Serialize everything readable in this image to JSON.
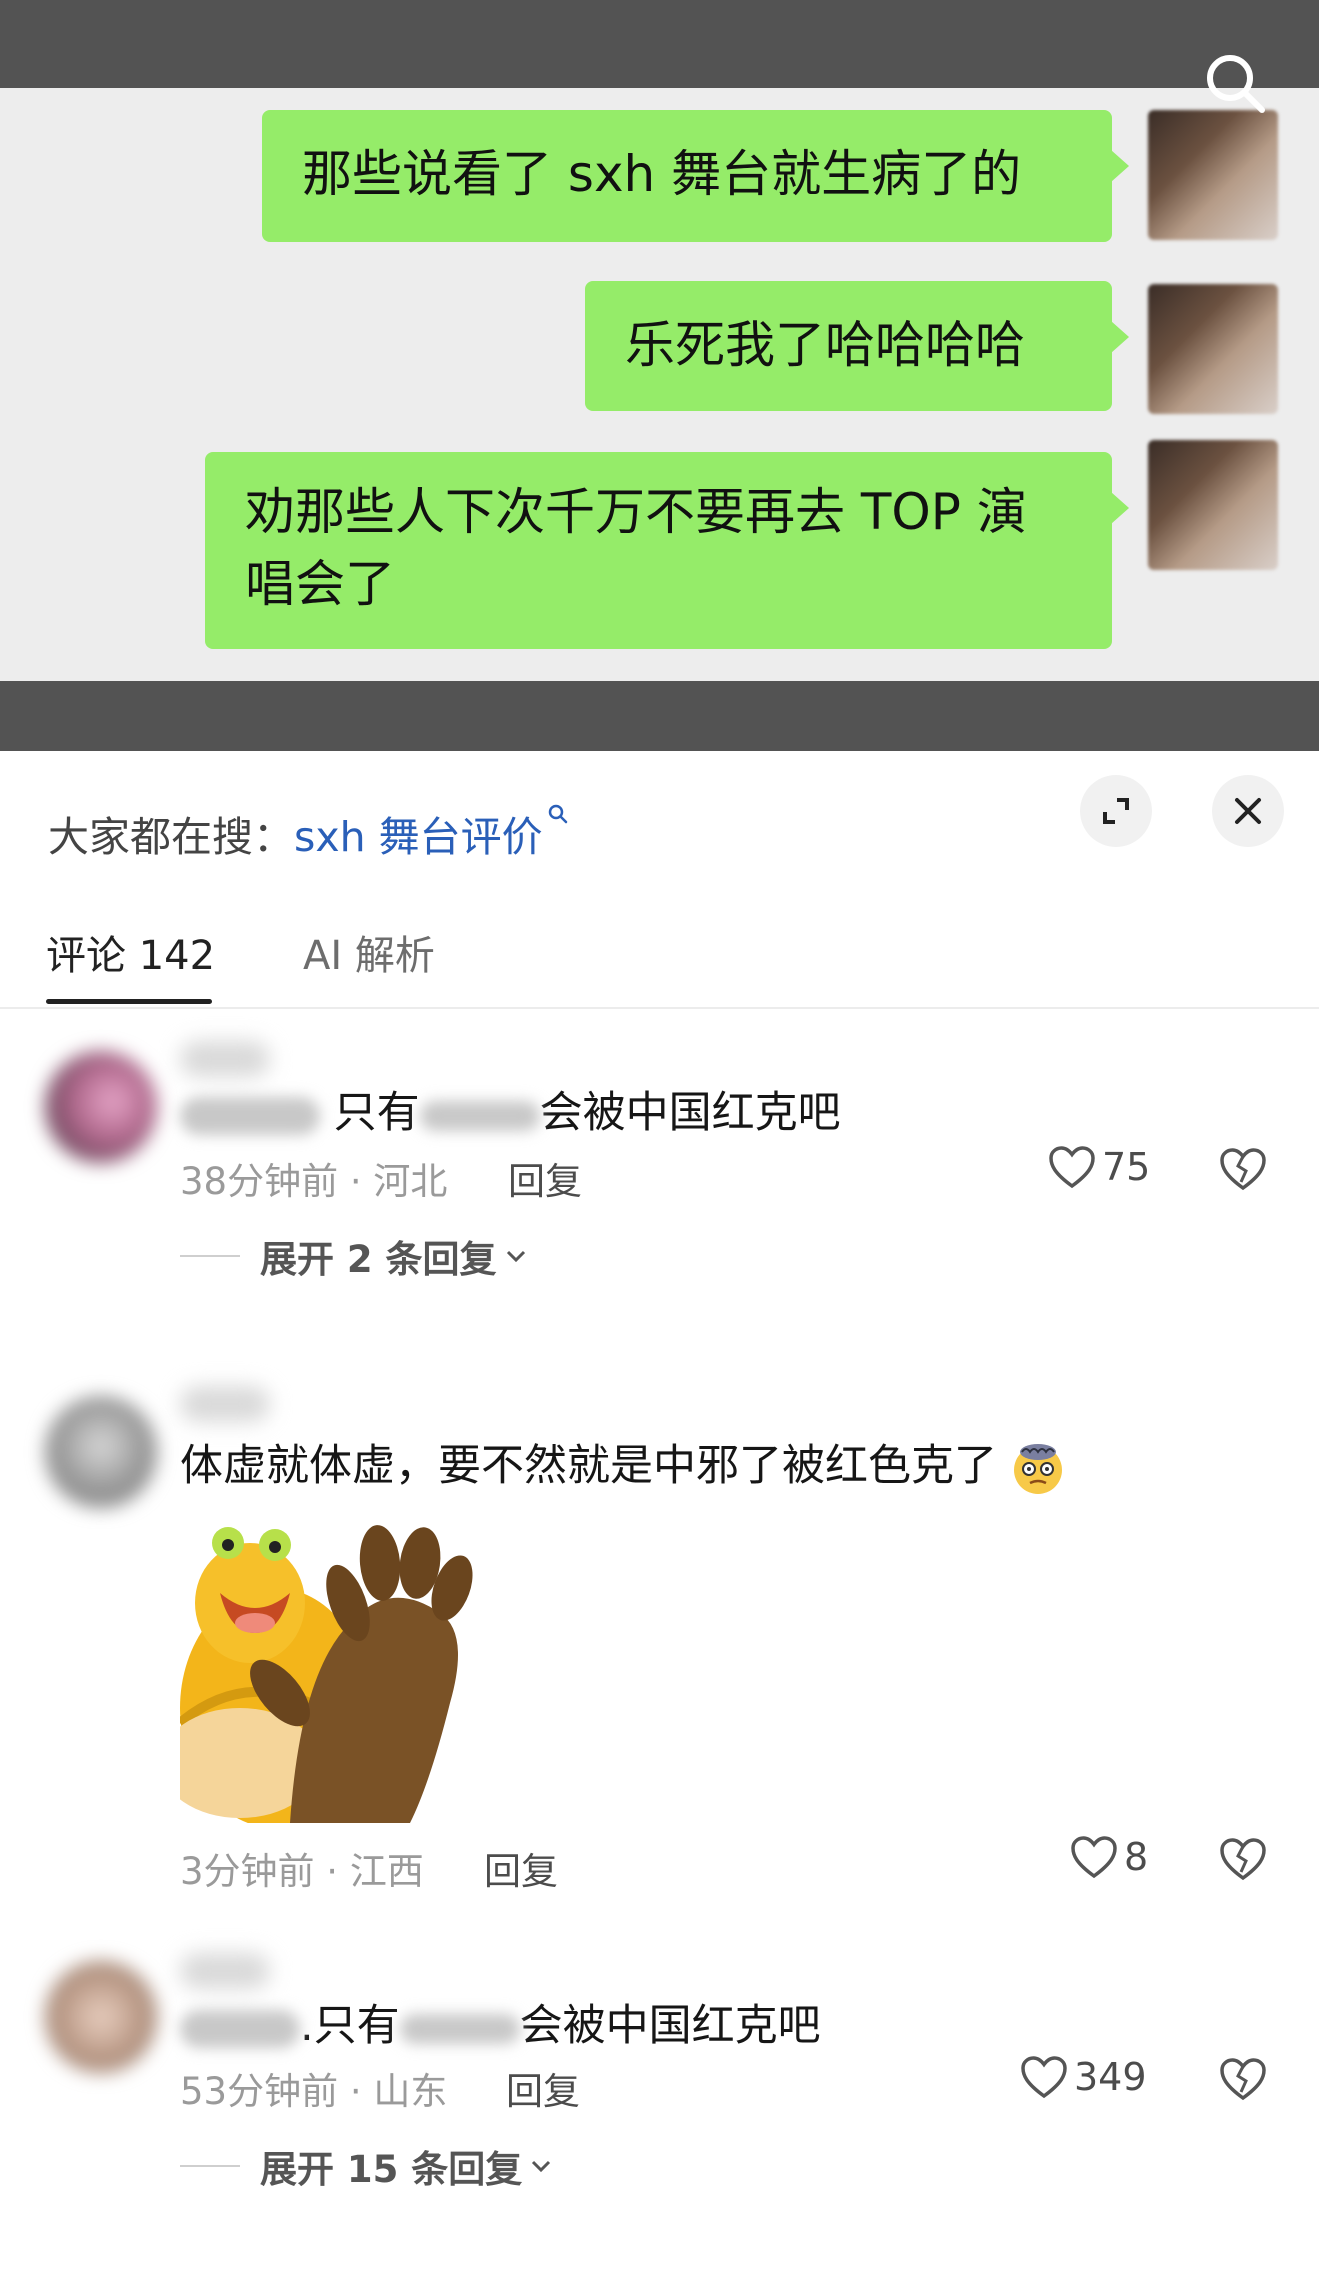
{
  "chat": {
    "messages": [
      {
        "text": "那些说看了 sxh 舞台就生病了的"
      },
      {
        "text": "乐死我了哈哈哈哈"
      },
      {
        "text": "劝那些人下次千万不要再去 TOP 演唱会了"
      }
    ],
    "bubble_color": "#95ec69"
  },
  "sheet": {
    "search_prefix": "大家都在搜：",
    "search_term": "sxh 舞台评价",
    "tabs": [
      {
        "label": "评论 142",
        "active": true
      },
      {
        "label": "AI 解析",
        "active": false
      }
    ],
    "comments": [
      {
        "text_pre": "",
        "text": "只有",
        "text_mid": "会被中国红克吧",
        "time_loc": "38分钟前 · 河北",
        "reply": "回复",
        "likes": "75",
        "expand": "展开 2 条回复"
      },
      {
        "text": "体虚就体虚，要不然就是中邪了被红色克了",
        "time_loc": "3分钟前 · 江西",
        "reply": "回复",
        "likes": "8",
        "emoji": "dizzy-face-emoji",
        "sticker": "cartoon-sticker-image"
      },
      {
        "text_pre": ".",
        "text": "只有",
        "text_mid": "会被中国红克吧",
        "time_loc": "53分钟前 · 山东",
        "reply": "回复",
        "likes": "349",
        "expand": "展开 15 条回复"
      }
    ],
    "link_color": "#2a5fb8"
  },
  "icons": [
    "search-icon",
    "expand-icon",
    "close-icon",
    "heart-icon",
    "broken-heart-icon",
    "chevron-down-icon"
  ]
}
